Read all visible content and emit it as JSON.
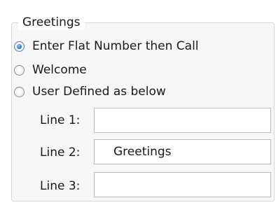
{
  "group": {
    "title": "Greetings"
  },
  "options": [
    {
      "label": "Enter Flat Number then Call",
      "selected": true
    },
    {
      "label": "Welcome",
      "selected": false
    },
    {
      "label": "User Defined as below",
      "selected": false
    }
  ],
  "lines": [
    {
      "label": "Line 1:",
      "value": ""
    },
    {
      "label": "Line 2:",
      "value": "Greetings"
    },
    {
      "label": "Line 3:",
      "value": ""
    }
  ]
}
